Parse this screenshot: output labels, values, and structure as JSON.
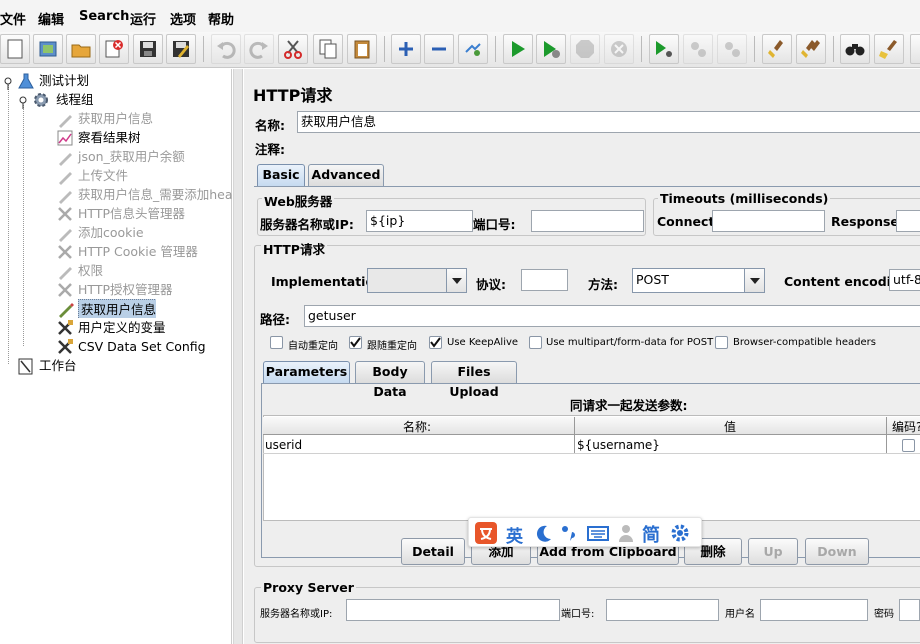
{
  "menu": {
    "file": "文件",
    "edit": "编辑",
    "search": "Search",
    "run": "运行",
    "options": "选项",
    "help": "帮助"
  },
  "tree": {
    "items": [
      {
        "label": "测试计划",
        "dim": false
      },
      {
        "label": "线程组",
        "dim": false
      },
      {
        "label": "获取用户信息",
        "dim": true
      },
      {
        "label": "察看结果树",
        "dim": false
      },
      {
        "label": "json_获取用户余额",
        "dim": true
      },
      {
        "label": "上传文件",
        "dim": true
      },
      {
        "label": "获取用户信息_需要添加head",
        "dim": true
      },
      {
        "label": "HTTP信息头管理器",
        "dim": true
      },
      {
        "label": "添加cookie",
        "dim": true
      },
      {
        "label": "HTTP Cookie 管理器",
        "dim": true
      },
      {
        "label": "权限",
        "dim": true
      },
      {
        "label": "HTTP授权管理器",
        "dim": true
      },
      {
        "label": "获取用户信息",
        "dim": false
      },
      {
        "label": "用户定义的变量",
        "dim": false
      },
      {
        "label": "CSV Data Set Config",
        "dim": false
      },
      {
        "label": "工作台",
        "dim": false
      }
    ]
  },
  "panel": {
    "title": "HTTP请求",
    "name_label": "名称:",
    "name_value": "获取用户信息",
    "comment_label": "注释:",
    "tabs": {
      "basic": "Basic",
      "advanced": "Advanced"
    },
    "web_server": {
      "legend": "Web服务器",
      "server_label": "服务器名称或IP:",
      "server_value": "${ip}",
      "port_label": "端口号:",
      "port_value": ""
    },
    "timeouts": {
      "legend": "Timeouts (milliseconds)",
      "connect_label": "Connect:",
      "response_label": "Response:"
    },
    "http_request": {
      "legend": "HTTP请求",
      "impl_label": "Implementation:",
      "impl_value": "",
      "protocol_label": "协议:",
      "protocol_value": "",
      "method_label": "方法:",
      "method_value": "POST",
      "encoding_label": "Content encoding:",
      "encoding_value": "utf-8",
      "path_label": "路径:",
      "path_value": "getuser"
    },
    "checkboxes": [
      {
        "label": "自动重定向",
        "checked": false
      },
      {
        "label": "跟随重定向",
        "checked": true
      },
      {
        "label": "Use KeepAlive",
        "checked": true
      },
      {
        "label": "Use multipart/form-data for POST",
        "checked": false
      },
      {
        "label": "Browser-compatible headers",
        "checked": false
      }
    ],
    "subtabs": {
      "parameters": "Parameters",
      "body": "Body Data",
      "files": "Files Upload"
    },
    "params": {
      "caption": "同请求一起发送参数:",
      "col_name": "名称:",
      "col_value": "值",
      "col_encode": "编码?",
      "rows": [
        {
          "name": "userid",
          "value": "${username}",
          "encode": false
        }
      ]
    },
    "buttons": {
      "detail": "Detail",
      "add": "添加",
      "clipboard": "Add from Clipboard",
      "delete": "删除",
      "up": "Up",
      "down": "Down"
    },
    "proxy": {
      "legend": "Proxy Server",
      "server_label": "服务器名称或IP:",
      "port_label": "端口号:",
      "user_label": "用户名",
      "pass_label": "密码"
    }
  },
  "ime": {
    "english": "英",
    "simplified": "简"
  },
  "colors": {
    "accent": "#7a90ad",
    "selection": "#b9cfe6",
    "ime": "#e8562a",
    "ime_blue": "#2a6fd0"
  }
}
